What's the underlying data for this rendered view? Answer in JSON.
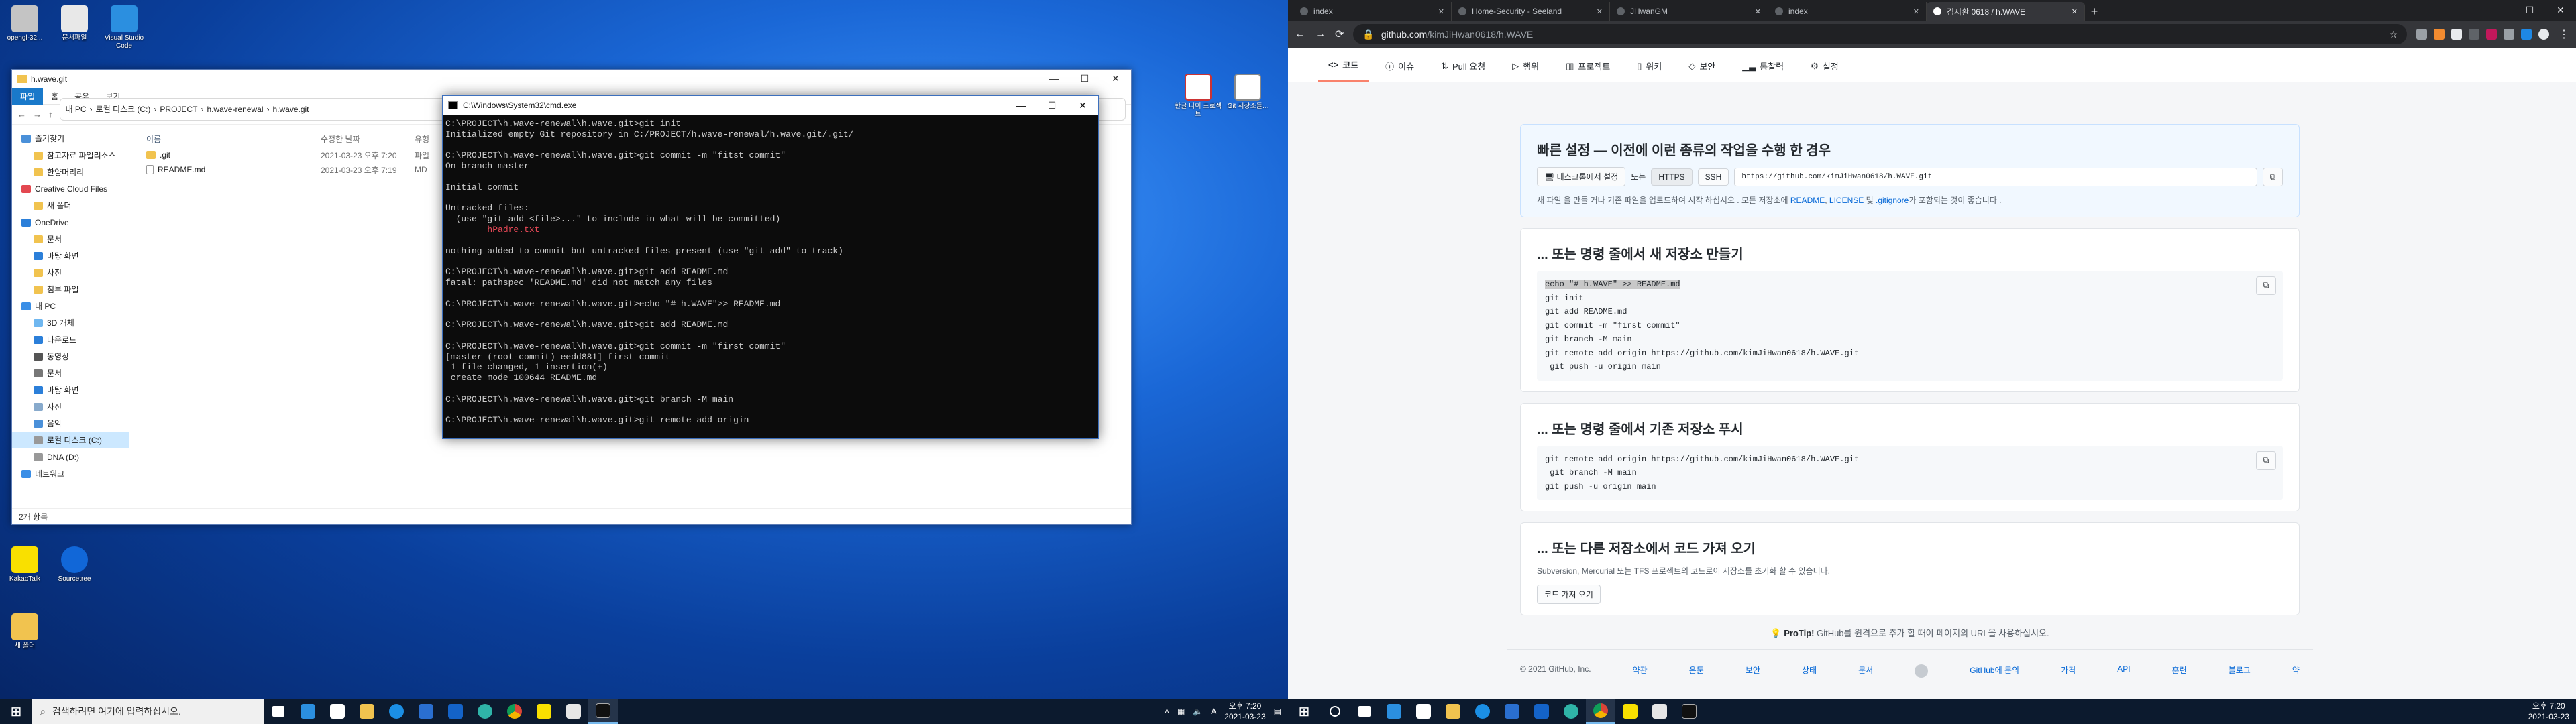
{
  "left_screen": {
    "desktop_icons": [
      {
        "label": "opengl-32..."
      },
      {
        "label": "문서파일"
      },
      {
        "label": "Visual Studio Code"
      },
      {
        "label": "한글 다이 프로젝트"
      },
      {
        "label": "Git 저장소들..."
      },
      {
        "label": "KakaoTalk"
      },
      {
        "label": "Sourcetree"
      },
      {
        "label": "새 폴더"
      }
    ],
    "explorer": {
      "title": "h.wave.git",
      "ribbon": [
        "파일",
        "홈",
        "공유",
        "보기"
      ],
      "path": [
        "내 PC",
        "로컬 디스크 (C:)",
        "PROJECT",
        "h.wave-renewal",
        "h.wave.git"
      ],
      "sidebar": [
        "즐겨찾기",
        "참고자료 파일리소스",
        "한양머리리",
        "Creative Cloud Files",
        "새 폴더",
        "OneDrive",
        "문서",
        "바탕 화면",
        "사진",
        "첨부 파일",
        "내 PC",
        "3D 개체",
        "다운로드",
        "동영상",
        "문서",
        "바탕 화면",
        "사진",
        "음악",
        "로컬 디스크 (C:)",
        "DNA (D:)",
        "네트워크"
      ],
      "columns": {
        "name": "이름",
        "date": "수정한 날짜",
        "type": "유형"
      },
      "files": [
        {
          "name": ".git",
          "date": "2021-03-23 오후 7:20",
          "type": "파일"
        },
        {
          "name": "README.md",
          "date": "2021-03-23 오후 7:19",
          "type": "MD"
        }
      ],
      "status": "2개 항목"
    },
    "cmd": {
      "title": "C:\\Windows\\System32\\cmd.exe",
      "lines": [
        "C:\\PROJECT\\h.wave-renewal\\h.wave.git>git init",
        "Initialized empty Git repository in C:/PROJECT/h.wave-renewal/h.wave.git/.git/",
        "",
        "C:\\PROJECT\\h.wave-renewal\\h.wave.git>git commit -m \"fitst commit\"",
        "On branch master",
        "",
        "Initial commit",
        "",
        "Untracked files:",
        "  (use \"git add <file>...\" to include in what will be committed)",
        "        hPadre.txt",
        "",
        "nothing added to commit but untracked files present (use \"git add\" to track)",
        "",
        "C:\\PROJECT\\h.wave-renewal\\h.wave.git>git add README.md",
        "fatal: pathspec 'README.md' did not match any files",
        "",
        "C:\\PROJECT\\h.wave-renewal\\h.wave.git>echo \"# h.WAVE\">> README.md",
        "",
        "C:\\PROJECT\\h.wave-renewal\\h.wave.git>git add README.md",
        "",
        "C:\\PROJECT\\h.wave-renewal\\h.wave.git>git commit -m \"first commit\"",
        "[master (root-commit) eedd881] first commit",
        " 1 file changed, 1 insertion(+)",
        " create mode 100644 README.md",
        "",
        "C:\\PROJECT\\h.wave-renewal\\h.wave.git>git branch -M main",
        "",
        "C:\\PROJECT\\h.wave-renewal\\h.wave.git>git remote add origin"
      ],
      "red_line_index": 10
    },
    "taskbar": {
      "search_placeholder": "검색하려면 여기에 입력하십시오.",
      "time": "오후 7:20",
      "date": "2021-03-23",
      "lang": "A"
    }
  },
  "right_screen": {
    "tabs": [
      {
        "title": "index"
      },
      {
        "title": "Home-Security - Seeland"
      },
      {
        "title": "JHwanGM"
      },
      {
        "title": "index"
      },
      {
        "title": "김지환 0618 / h.WAVE"
      }
    ],
    "url_host": "github.com",
    "url_path": "/kimJiHwan0618/h.WAVE",
    "repo_nav": [
      "코드",
      "이슈",
      "Pull 요청",
      "행위",
      "프로젝트",
      "위키",
      "보안",
      "통찰력",
      "설정"
    ],
    "quick_setup": {
      "title": "빠른 설정 — 이전에 이런 종류의 작업을 수행 한 경우",
      "desktop_btn": "데스크톱에서 설정",
      "or": "또는",
      "https": "HTTPS",
      "ssh": "SSH",
      "url": "https://github.com/kimJiHwan0618/h.WAVE.git",
      "note_prefix": "새 파일 을 만들 거나 기존 파일을 업로드하여 시작 하십시오 . 모든 저장소에",
      "note_readme": "README",
      "note_license": "LICENSE",
      "note_gitignore": ".gitignore",
      "note_suffix": "가 포함되는 것이 좋습니다 ."
    },
    "create_section": {
      "title": "... 또는 명령 줄에서 새 저장소 만들기",
      "first_line": "echo \"# h.WAVE\" >> README.md",
      "rest": "git init\ngit add README.md\ngit commit -m \"first commit\"\ngit branch -M main\ngit remote add origin https://github.com/kimJiHwan0618/h.WAVE.git\n git push -u origin main"
    },
    "push_section": {
      "title": "... 또는 명령 줄에서 기존 저장소 푸시",
      "code": "git remote add origin https://github.com/kimJiHwan0618/h.WAVE.git\n git branch -M main\ngit push -u origin main"
    },
    "import_section": {
      "title": "... 또는 다른 저장소에서 코드 가져 오기",
      "desc": "Subversion, Mercurial 또는 TFS 프로젝트의 코드로이 저장소를 초기화 할 수 있습니다.",
      "button": "코드 가져 오기"
    },
    "protip_bold": "ProTip!",
    "protip": "GitHub를 원격으로 추가 할 때이 페이지의 URL을 사용하십시오.",
    "footer": [
      "© 2021 GitHub, Inc.",
      "약관",
      "은둔",
      "보안",
      "상태",
      "문서",
      "GitHub에 문의",
      "가격",
      "API",
      "훈련",
      "블로그",
      "약"
    ],
    "taskbar": {
      "time": "오후 7:20",
      "date": "2021-03-23"
    }
  },
  "colors": {
    "github_blue": "#0366d6",
    "tab_underline": "#f9826c",
    "desktop_blue": "#1a67d6"
  }
}
